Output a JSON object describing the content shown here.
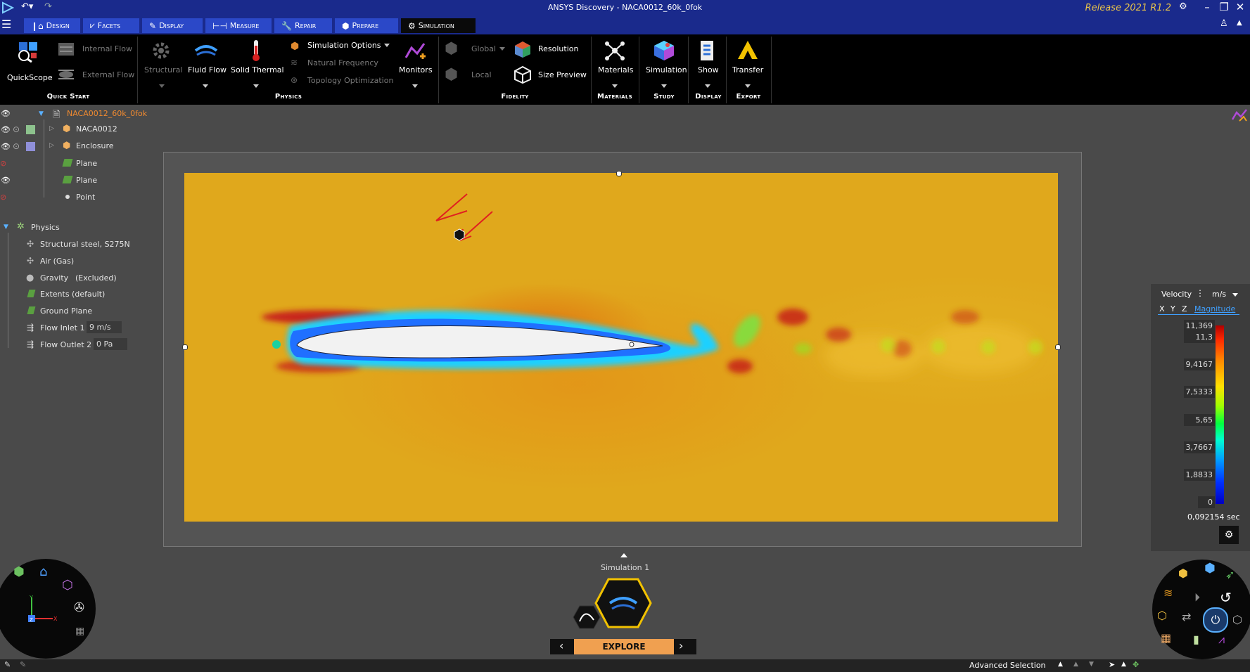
{
  "window": {
    "title": "ANSYS Discovery - NACA0012_60k_0fok",
    "release": "Release 2021 R1.2"
  },
  "tabs": [
    {
      "label": "Design",
      "icon": "design-icon"
    },
    {
      "label": "Facets",
      "icon": "facets-icon"
    },
    {
      "label": "Display",
      "icon": "display-icon"
    },
    {
      "label": "Measure",
      "icon": "measure-icon"
    },
    {
      "label": "Repair",
      "icon": "repair-icon"
    },
    {
      "label": "Prepare",
      "icon": "prepare-icon"
    },
    {
      "label": "Simulation",
      "icon": "simulation-icon",
      "active": true
    }
  ],
  "ribbon": {
    "quickstart": {
      "quickscope": "QuickScope",
      "internal_flow": "Internal Flow",
      "external_flow": "External Flow",
      "group": "Quick Start"
    },
    "physics": {
      "structural": "Structural",
      "fluid_flow": "Fluid Flow",
      "solid_thermal": "Solid Thermal",
      "simulation_options": "Simulation Options",
      "natural_frequency": "Natural Frequency",
      "topology_optimization": "Topology Optimization",
      "monitors": "Monitors",
      "group": "Physics"
    },
    "fidelity": {
      "global": "Global",
      "local": "Local",
      "resolution": "Resolution",
      "size_preview": "Size Preview",
      "group": "Fidelity"
    },
    "materials": {
      "label": "Materials",
      "group": "Materials"
    },
    "study": {
      "label": "Simulation",
      "group": "Study"
    },
    "display": {
      "label": "Show",
      "group": "Display"
    },
    "export": {
      "label": "Transfer",
      "group": "Export"
    }
  },
  "tree": {
    "root": "NACA0012_60k_0fok",
    "items": [
      {
        "label": "NACA0012",
        "swatch": "#8dc28d"
      },
      {
        "label": "Enclosure",
        "swatch": "#8f8fd8"
      },
      {
        "label": "Plane"
      },
      {
        "label": "Plane"
      },
      {
        "label": "Point"
      }
    ],
    "physics": {
      "label": "Physics",
      "items": [
        {
          "label": "Structural steel, S275N",
          "value": ""
        },
        {
          "label": "Air (Gas)",
          "value": ""
        },
        {
          "label": "Gravity",
          "value": "(Excluded)"
        },
        {
          "label": "Extents (default)",
          "value": ""
        },
        {
          "label": "Ground Plane",
          "value": ""
        },
        {
          "label": "Flow Inlet 1",
          "value": "9 m/s"
        },
        {
          "label": "Flow Outlet 2",
          "value": "0 Pa"
        }
      ]
    }
  },
  "legend": {
    "quantity": "Velocity",
    "unit": "m/s",
    "axes": [
      "X",
      "Y",
      "Z"
    ],
    "component": "Magnitude",
    "max": "11,369",
    "max2": "11,3",
    "ticks": [
      "9,4167",
      "7,5333",
      "5,65",
      "3,7667",
      "1,8833",
      "0"
    ],
    "time": "0,092154 sec"
  },
  "stage": {
    "name": "Simulation 1",
    "mode": "Explore"
  },
  "status": {
    "advanced_selection": "Advanced Selection"
  }
}
